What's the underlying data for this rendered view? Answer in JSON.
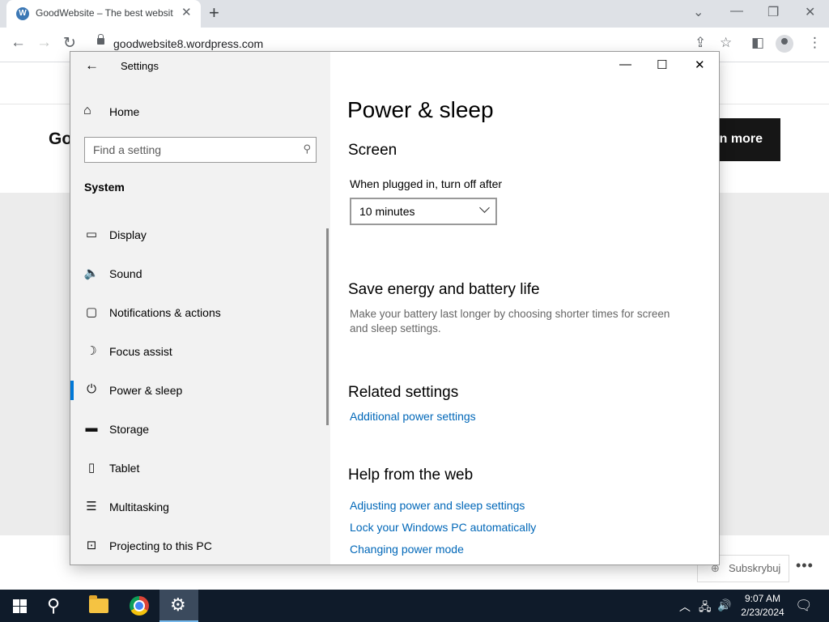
{
  "browser": {
    "tab_title": "GoodWebsite – The best website",
    "tab_icon": "W",
    "url": "goodwebsite8.wordpress.com",
    "new_tab": "+",
    "close": "✕"
  },
  "page": {
    "heading_fragment": "Go",
    "learn_more": "rn more",
    "subscribe": "Subskrybuj",
    "more": "•••"
  },
  "settings": {
    "window_title": "Settings",
    "back": "←",
    "home": "Home",
    "search_placeholder": "Find a setting",
    "category": "System",
    "nav_items": [
      {
        "label": "Display",
        "icon": "display-icon"
      },
      {
        "label": "Sound",
        "icon": "speaker-icon"
      },
      {
        "label": "Notifications & actions",
        "icon": "message-icon"
      },
      {
        "label": "Focus assist",
        "icon": "moon-icon"
      },
      {
        "label": "Power & sleep",
        "icon": "power-icon",
        "selected": true
      },
      {
        "label": "Storage",
        "icon": "storage-icon"
      },
      {
        "label": "Tablet",
        "icon": "tablet-icon"
      },
      {
        "label": "Multitasking",
        "icon": "multitasking-icon"
      },
      {
        "label": "Projecting to this PC",
        "icon": "projector-icon"
      }
    ],
    "page_title": "Power & sleep",
    "screen_heading": "Screen",
    "plugged_label": "When plugged in, turn off after",
    "plugged_value": "10 minutes",
    "save_heading": "Save energy and battery life",
    "save_desc": "Make your battery last longer by choosing shorter times for screen and sleep settings.",
    "related_heading": "Related settings",
    "related_link": "Additional power settings",
    "help_heading": "Help from the web",
    "help_links": [
      "Adjusting power and sleep settings",
      "Lock your Windows PC automatically",
      "Changing power mode"
    ]
  },
  "taskbar": {
    "time": "9:07 AM",
    "date": "2/23/2024"
  },
  "colors": {
    "accent": "#0078d7",
    "link": "#0067b8",
    "taskbar": "#0f1b2a"
  }
}
